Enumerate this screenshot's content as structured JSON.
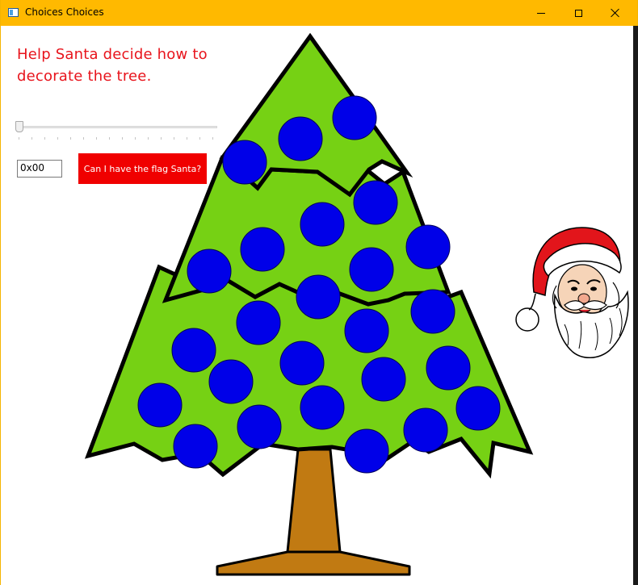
{
  "window": {
    "title": "Choices Choices",
    "controls": {
      "minimize_icon": "minimize-icon",
      "maximize_icon": "maximize-icon",
      "close_icon": "close-icon"
    }
  },
  "main": {
    "heading": "Help Santa decide how to decorate the tree.",
    "slider": {
      "value": 0
    },
    "value_field": "0x00",
    "flag_button": "Can I have the flag Santa?"
  },
  "colors": {
    "titlebar": "#ffb900",
    "heading_text": "#e8141c",
    "button_bg": "#f00000",
    "tree_green": "#76d114",
    "ornament_blue": "#0000e8",
    "trunk_brown": "#c17a12"
  }
}
